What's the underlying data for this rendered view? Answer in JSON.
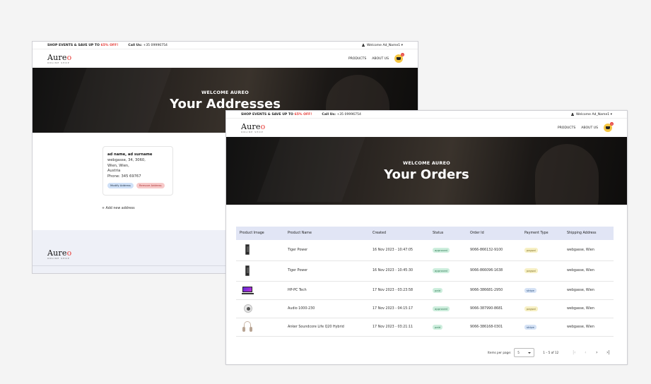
{
  "shared": {
    "promo_prefix": "SHOP EVENTS & SAVE UP TO ",
    "promo_pct": "65% OFF!",
    "call_label": "Call Us:",
    "call_number": " +35 09996754",
    "user_greeting": "Welcome Ad_Name1 ▾",
    "logo_word": "Aure",
    "logo_o": "o",
    "logo_sub": "ONLINE SHOP",
    "nav_products": "PRODUCTS",
    "nav_about": "ABOUT US",
    "cart_count": "0"
  },
  "addresses_window": {
    "hero_welcome": "WELCOME AUREO",
    "hero_title": "Your Addresses",
    "card": {
      "name": "ad name, ad surname",
      "line1": "webgasse, 34, 3060,",
      "line2": "Wien, Wien,",
      "line3": "Austria",
      "phone": "Phone: 345 69767",
      "modify_label": "Modify Address",
      "remove_label": "Remove Address"
    },
    "add_address_label": "+ Add new address"
  },
  "orders_window": {
    "hero_welcome": "WELCOME AUREO",
    "hero_title": "Your Orders",
    "columns": [
      "Product Image",
      "Product Name",
      "Created",
      "Status",
      "Order Id",
      "Payment Type",
      "Shipping Address"
    ],
    "rows": [
      {
        "image": "phone",
        "name": "Tiger Power",
        "created": "16 Nov 2023 - 10:47:05",
        "status": "approved",
        "order_id": "9066-866132-9100",
        "payment": "paypal",
        "address": "webgasse, Wien"
      },
      {
        "image": "phone",
        "name": "Tiger Power",
        "created": "16 Nov 2023 - 10:45:30",
        "status": "approved",
        "order_id": "9066-866096-1638",
        "payment": "paypal",
        "address": "webgasse, Wien"
      },
      {
        "image": "laptop",
        "name": "HP-PC Tech",
        "created": "17 Nov 2023 - 03:23:58",
        "status": "paid",
        "order_id": "9066-386681-2950",
        "payment": "stripe",
        "address": "webgasse, Wien"
      },
      {
        "image": "speaker",
        "name": "Audio 1000-230",
        "created": "17 Nov 2023 - 04:15:17",
        "status": "approved",
        "order_id": "9066-387990-8681",
        "payment": "paypal",
        "address": "webgasse, Wien"
      },
      {
        "image": "headphones",
        "name": "Anker Soundcore Life Q20 Hybrid",
        "created": "17 Nov 2023 - 03:21:11",
        "status": "paid",
        "order_id": "9066-386168-0301",
        "payment": "stripe",
        "address": "webgasse, Wien"
      }
    ],
    "paginator": {
      "items_per_page_label": "Items per page:",
      "items_per_page_value": "5",
      "range_label": "1 – 5 of 12",
      "first": "|‹",
      "prev": "‹",
      "next": "›",
      "last": "›|"
    }
  }
}
